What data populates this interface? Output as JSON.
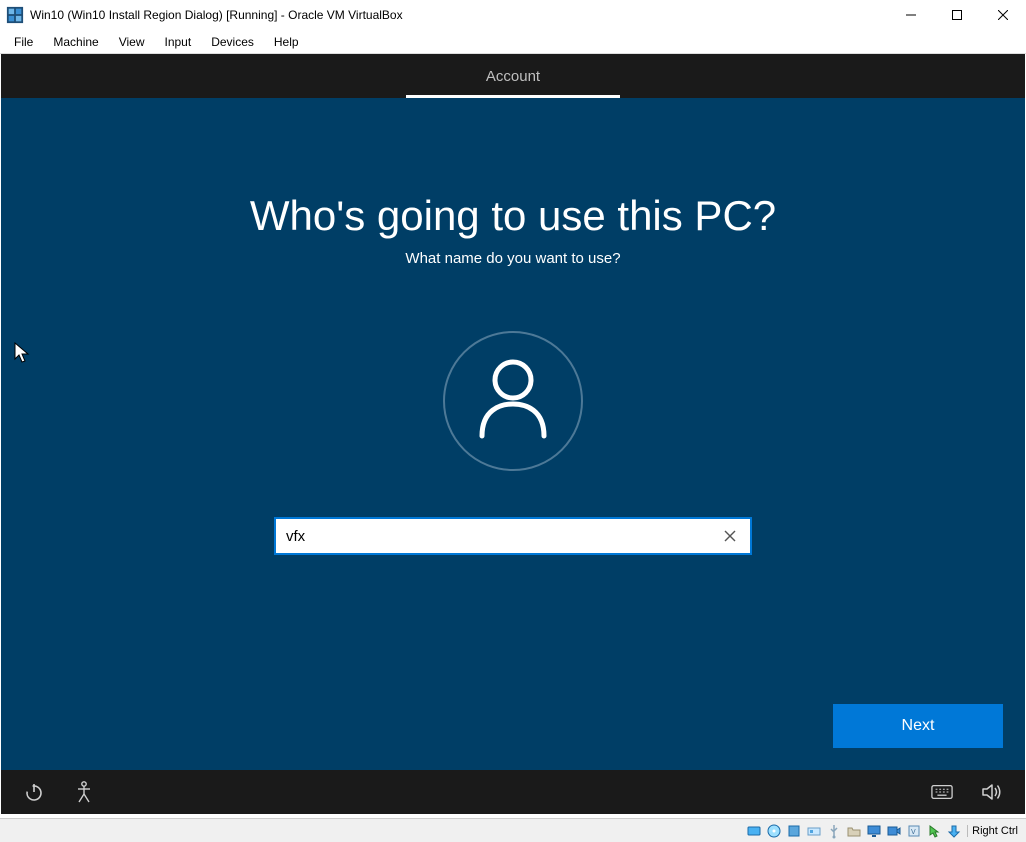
{
  "virtualbox": {
    "title": "Win10 (Win10 Install Region Dialog) [Running] - Oracle VM VirtualBox",
    "menu": [
      "File",
      "Machine",
      "View",
      "Input",
      "Devices",
      "Help"
    ],
    "host_key": "Right Ctrl"
  },
  "oobe": {
    "tab": "Account",
    "heading": "Who's going to use this PC?",
    "sub": "What name do you want to use?",
    "username_value": "vfx",
    "next_label": "Next"
  }
}
